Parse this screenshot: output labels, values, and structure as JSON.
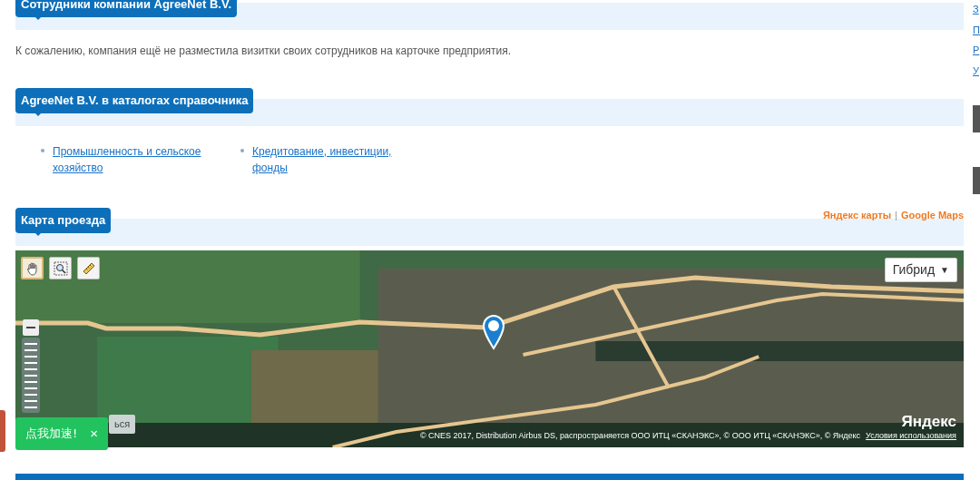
{
  "sections": [
    {
      "kind": "text",
      "title": "Сотрудники компании AgreeNet B.V.",
      "text": "К сожалению, компания ещё не разместила визитки своих сотрудников на карточке предприятия."
    },
    {
      "kind": "links",
      "title": "AgreeNet B.V. в каталогах справочника",
      "links": [
        "Промышленность и сельское хозяйство",
        "Кредитование, инвестиции, фонды"
      ]
    },
    {
      "kind": "map",
      "title": "Карта проезда",
      "providers": [
        "Яндекс карты",
        "Google Maps"
      ],
      "separator": "|",
      "map": {
        "tools": [
          {
            "kind": "hand",
            "selected": true
          },
          {
            "kind": "zoom",
            "selected": false
          },
          {
            "kind": "ruler",
            "selected": false
          }
        ],
        "type_button": "Гибрид",
        "type_caret": "▼",
        "hidden_button": "ься",
        "copyright": "© CNES 2017, Distribution Airbus DS, распространяется ООО ИТЦ «СКАНЭКС», © ООО ИТЦ «СКАНЭКС», © Яндекс",
        "terms": "Условия использования",
        "logo": "Яндекс"
      }
    }
  ],
  "sidebar": {
    "links": [
      "З",
      "П",
      "Р",
      "У"
    ]
  },
  "promo": {
    "label": "点我加速!",
    "close": "×"
  }
}
